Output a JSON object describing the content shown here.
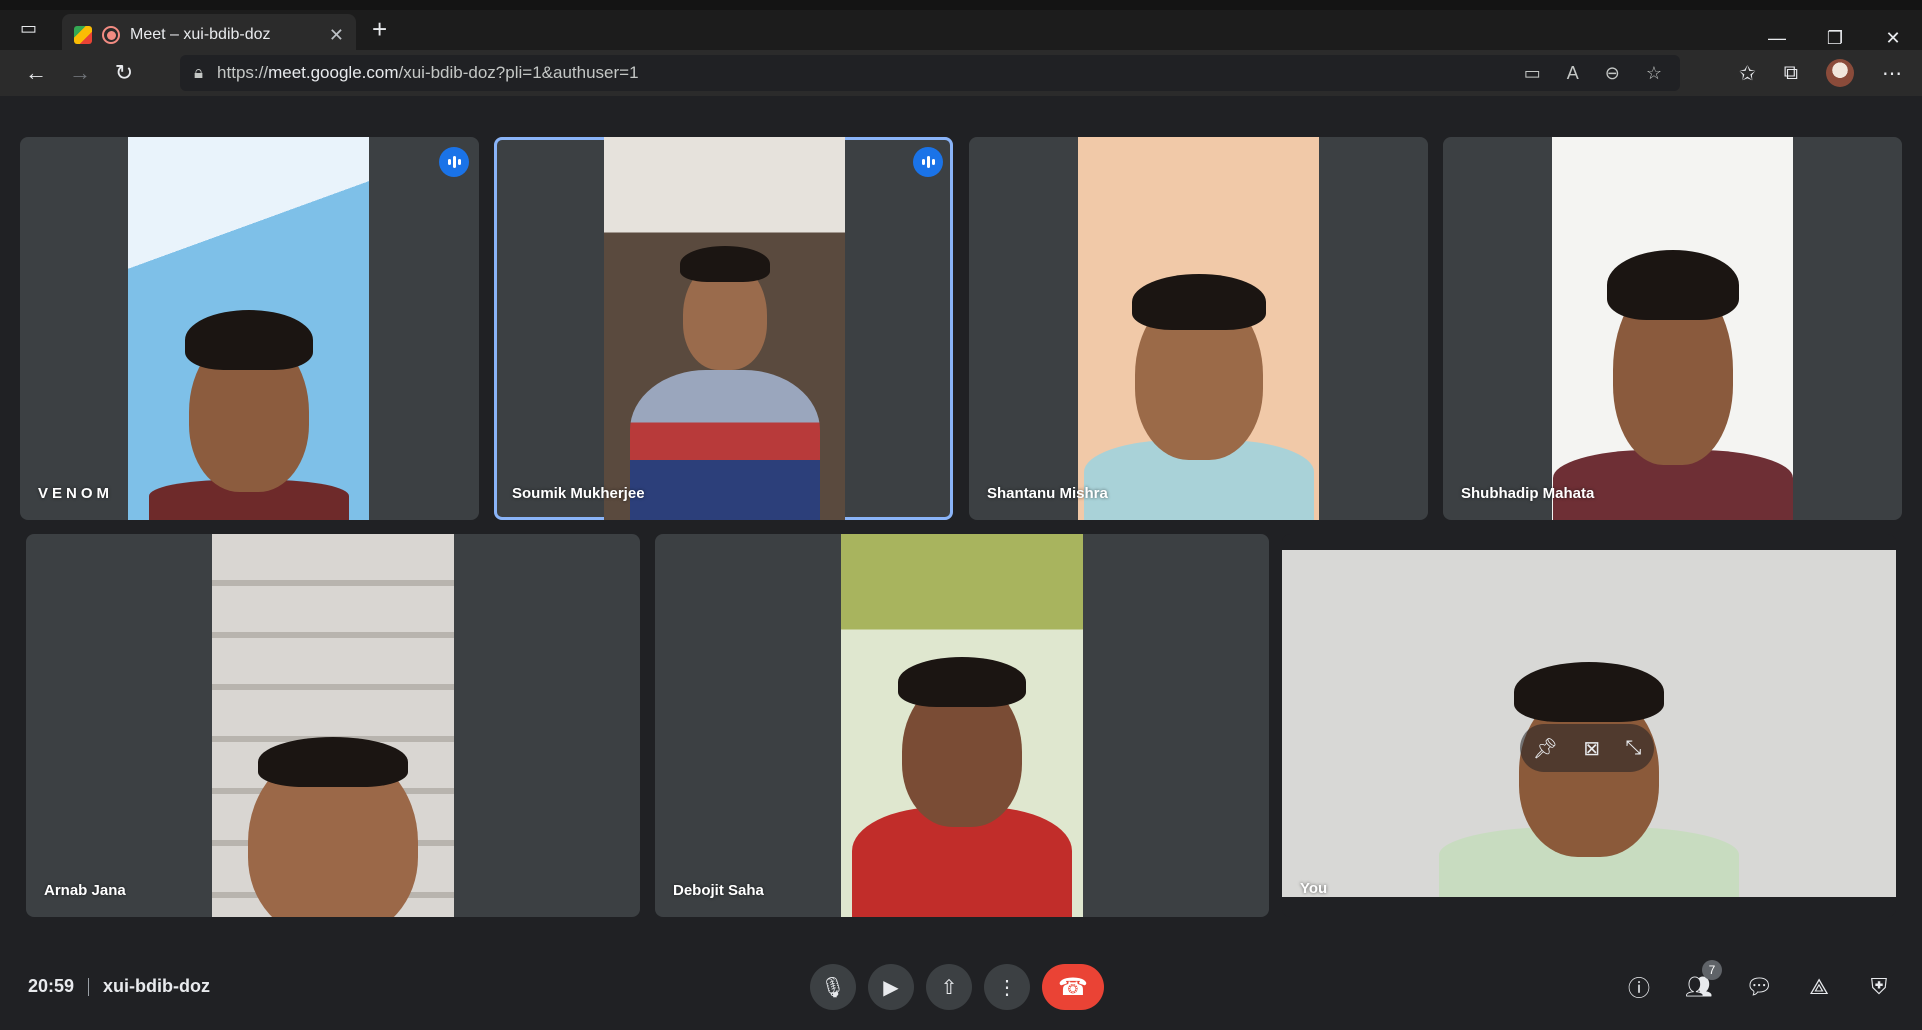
{
  "browser": {
    "tab_title": "Meet – xui-bdib-doz",
    "tab_close": "✕",
    "new_tab": "+",
    "url_prefix": "https://",
    "url_host": "meet.google.com",
    "url_path": "/xui-bdib-doz?pli=1&authuser=1",
    "window_minimize": "—",
    "window_restore": "❐",
    "window_close": "✕"
  },
  "participants": [
    {
      "name": "VENOM",
      "speaking": true
    },
    {
      "name": "Soumik Mukherjee",
      "speaking": true,
      "active": true
    },
    {
      "name": "Shantanu Mishra"
    },
    {
      "name": "Shubhadip Mahata"
    },
    {
      "name": "Arnab Jana"
    },
    {
      "name": "Debojit Saha"
    },
    {
      "name": "You"
    }
  ],
  "footer": {
    "time": "20:59",
    "meeting_code": "xui-bdib-doz",
    "people_count": "7"
  },
  "colors": {
    "background": "#202124",
    "tile": "#3c4043",
    "accent": "#1a73e8",
    "end_call": "#ea4335"
  }
}
